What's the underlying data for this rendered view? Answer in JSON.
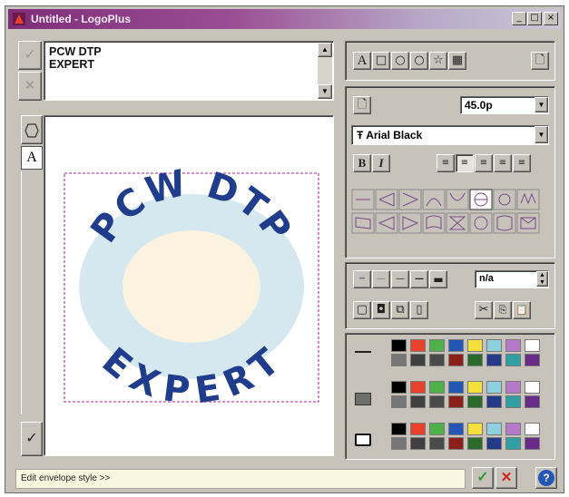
{
  "window": {
    "title": "Untitled - LogoPlus",
    "min_label": "_",
    "max_label": "□",
    "close_label": "×"
  },
  "editor": {
    "lines": [
      "PCW DTP",
      "EXPERT"
    ],
    "accept_icon": "check-icon",
    "reject_icon": "cross-icon"
  },
  "logo": {
    "top_text": "PCW DTP",
    "bottom_text": "EXPERT",
    "text_color": "#1f3d8c",
    "ring_color": "#cfe4ef",
    "center_color": "#fbf3df",
    "guide_color": "#c24aa6"
  },
  "side_tabs": [
    "A"
  ],
  "format": {
    "size_value": "45.0p",
    "font_value": "Arial Black",
    "bold_label": "B",
    "italic_label": "I",
    "style_value": "n/a"
  },
  "object_tools": [
    "A",
    "□",
    "○",
    "○",
    "☆",
    "▦"
  ],
  "status": {
    "text": "Edit envelope style >>",
    "ok_icon": "check-icon",
    "cancel_icon": "cross-icon",
    "help_label": "?"
  },
  "palette_colors": [
    [
      "#000000",
      "#e8412c",
      "#4fb04a",
      "#2456b8",
      "#f3e03a",
      "#8fd0e0",
      "#b678c9",
      "#ffffff"
    ],
    [
      "#777777",
      "#3f3f3f",
      "#4a4a4a",
      "#8a2017",
      "#2a6a2a",
      "#243a88",
      "#2f9fa3",
      "#6a2a8a"
    ]
  ]
}
